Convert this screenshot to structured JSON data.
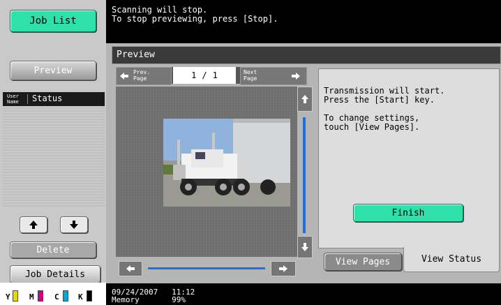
{
  "left_panel": {
    "job_list": "Job List",
    "preview": "Preview",
    "col_user": "User Name",
    "col_status": "Status",
    "delete": "Delete",
    "job_details": "Job Details",
    "up_icon": "arrow-up-icon",
    "down_icon": "arrow-down-icon"
  },
  "toner": {
    "y": "Y",
    "m": "M",
    "c": "C",
    "k": "K",
    "y_color": "#e6d800",
    "m_color": "#d0008a",
    "c_color": "#00a8d8",
    "k_color": "#000000"
  },
  "message": "Scanning will stop.\nTo stop previewing, press [Stop].",
  "preview": {
    "title": "Preview",
    "prev_page": "Prev. Page",
    "next_page": "Next Page",
    "page_current": "1",
    "page_sep": "/",
    "page_total": "1"
  },
  "status": {
    "text": "Transmission will start.\nPress the [Start] key.\n\nTo change settings,\ntouch [View Pages].",
    "finish": "Finish",
    "tab_view_pages": "View Pages",
    "tab_view_status": "View Status"
  },
  "footer": "09/24/2007   11:12\nMemory       99%",
  "colors": {
    "accent": "#2fe0a8",
    "scroll": "#1e6fe0"
  }
}
